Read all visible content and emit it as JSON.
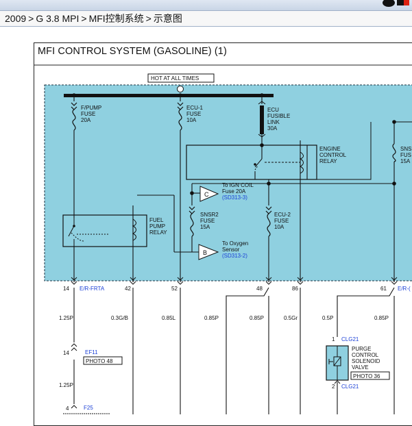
{
  "breadcrumb": [
    "2009",
    "G 3.8 MPI",
    "MFI控制系统",
    "示意图"
  ],
  "breadcrumb_sep": ">",
  "title": "MFI CONTROL SYSTEM (GASOLINE) (1)",
  "colors": {
    "harness_fill": "#8fd0e0",
    "wire": "#111111",
    "link_blue": "#1a3fd6"
  },
  "labels": {
    "hot": "HOT AT ALL TIMES",
    "fpump_fuse": [
      "F/PUMP",
      "FUSE",
      "20A"
    ],
    "ecu1_fuse": [
      "ECU-1",
      "FUSE",
      "10A"
    ],
    "ecu_link": [
      "ECU",
      "FUSIBLE",
      "LINK",
      "30A"
    ],
    "engine_relay": [
      "ENGINE",
      "CONTROL",
      "RELAY"
    ],
    "sns_fuse": [
      "SNS",
      "FUS",
      "15A"
    ],
    "c_letter": "C",
    "ign_coil": [
      "To IGN COIL",
      "Fuse 20A"
    ],
    "ign_ref": "(SD313-3)",
    "snsr2_fuse": [
      "SNSR2",
      "FUSE",
      "15A"
    ],
    "ecu2_fuse": [
      "ECU-2",
      "FUSE",
      "10A"
    ],
    "fuel_relay": [
      "FUEL",
      "PUMP",
      "RELAY"
    ],
    "b_letter": "B",
    "oxy": [
      "To Oxygen",
      "Sensor"
    ],
    "oxy_ref": "(SD313-2)",
    "pins": {
      "p14": "14",
      "erfrta": "E/R-FRTA",
      "p42": "42",
      "p52": "52",
      "p48": "48",
      "p86": "86",
      "p61": "61",
      "err": "E/R-("
    },
    "wires": {
      "w1": "1.25P",
      "w2": "0.3G/B",
      "w3": "0.85L",
      "w4": "0.85P",
      "w5": "0.85P",
      "w6": "0.5Gr",
      "w7": "0.5P",
      "w8": "0.85P"
    },
    "ef11_pin": "14",
    "ef11": "EF11",
    "photo48": "PHOTO 48",
    "w_low": "1.25P",
    "f25_pin": "4",
    "f25": "F25",
    "clg_top_pin": "1",
    "clg21_top": "CLG21",
    "purge": [
      "PURGE",
      "CONTROL",
      "SOLENOID",
      "VALVE"
    ],
    "photo36": "PHOTO 36",
    "clg_bot_pin": "2",
    "clg21_bot": "CLG21"
  }
}
